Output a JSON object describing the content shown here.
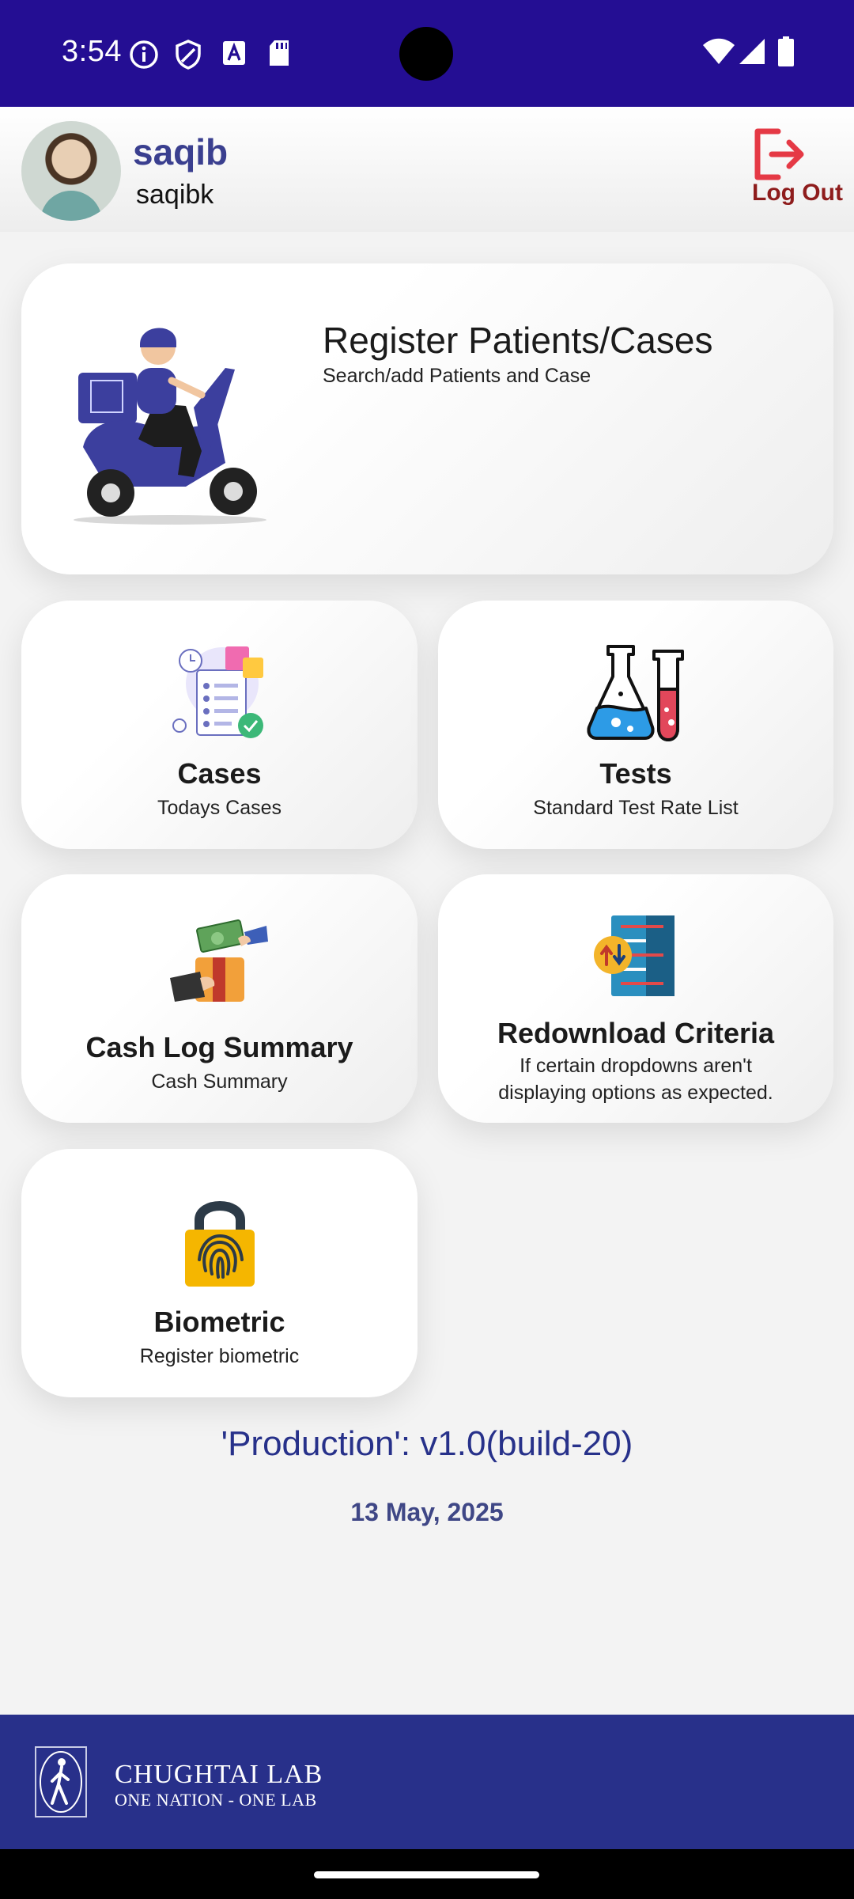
{
  "status_bar": {
    "time": "3:54"
  },
  "header": {
    "user_name": "saqib",
    "user_login": "saqibk",
    "logout_label": "Log Out"
  },
  "cards": {
    "register": {
      "title": "Register Patients/Cases",
      "subtitle": "Search/add Patients and Case"
    },
    "cases": {
      "title": "Cases",
      "subtitle": "Todays Cases"
    },
    "tests": {
      "title": "Tests",
      "subtitle": "Standard Test Rate List"
    },
    "cash_log": {
      "title": "Cash Log Summary",
      "subtitle": "Cash Summary"
    },
    "redownload": {
      "title": "Redownload Criteria",
      "subtitle_line1": "If certain dropdowns aren't",
      "subtitle_line2": "displaying options as expected."
    },
    "biometric": {
      "title": "Biometric",
      "subtitle": "Register biometric"
    }
  },
  "version_text": "'Production': v1.0(build-20)",
  "build_date": "13 May, 2025",
  "footer": {
    "brand_name": "CHUGHTAI LAB",
    "tagline": "ONE NATION - ONE LAB"
  },
  "colors": {
    "status_bar": "#240e93",
    "footer": "#28308a",
    "accent_text": "#27318a",
    "logout_red": "#e53945"
  },
  "icons": [
    "info-icon",
    "shield-icon",
    "a-icon",
    "sd-card-icon",
    "wifi-icon",
    "signal-icon",
    "battery-icon",
    "logout-icon",
    "scooter-illustration",
    "checklist-illustration",
    "flasks-illustration",
    "cash-illustration",
    "server-illustration",
    "fingerprint-lock-illustration"
  ]
}
